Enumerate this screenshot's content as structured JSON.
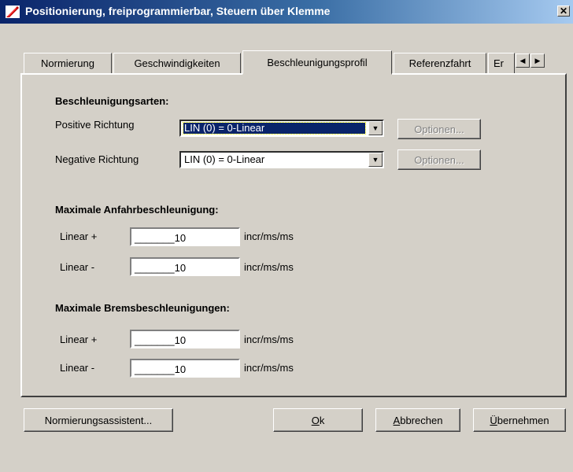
{
  "window": {
    "title": "Positionierung, freiprogrammierbar, Steuern über Klemme",
    "close_glyph": "✕"
  },
  "tabs": [
    {
      "label": "Normierung"
    },
    {
      "label": "Geschwindigkeiten"
    },
    {
      "label": "Beschleunigungsprofil",
      "active": true
    },
    {
      "label": "Referenzfahrt"
    },
    {
      "label": "Er"
    }
  ],
  "tab_scroll": {
    "left": "◀",
    "right": "▶"
  },
  "accel_types": {
    "heading": "Beschleunigungsarten:",
    "positive": {
      "label": "Positive Richtung",
      "value": "LIN (0) = 0-Linear",
      "options_button": "Optionen..."
    },
    "negative": {
      "label": "Negative Richtung",
      "value": "LIN (0) = 0-Linear",
      "options_button": "Optionen..."
    },
    "arrow": "▼"
  },
  "start_accel": {
    "heading": "Maximale Anfahrbeschleunigung:",
    "plus": {
      "label": "Linear +",
      "value": "_______10",
      "unit": "incr/ms/ms"
    },
    "minus": {
      "label": "Linear -",
      "value": "_______10",
      "unit": "incr/ms/ms"
    }
  },
  "brake_accel": {
    "heading": "Maximale Bremsbeschleunigungen:",
    "plus": {
      "label": "Linear +",
      "value": "_______10",
      "unit": "incr/ms/ms"
    },
    "minus": {
      "label": "Linear -",
      "value": "_______10",
      "unit": "incr/ms/ms"
    }
  },
  "footer": {
    "assistant": "Normierungsassistent...",
    "ok_mnemonic": "O",
    "ok_rest": "k",
    "cancel_mnemonic": "A",
    "cancel_rest": "bbrechen",
    "apply_mnemonic": "Ü",
    "apply_rest": "bernehmen"
  },
  "colors": {
    "titlebar_start": "#0a246a",
    "titlebar_end": "#a6caf0",
    "face": "#d4d0c8",
    "selection": "#0a246a"
  }
}
